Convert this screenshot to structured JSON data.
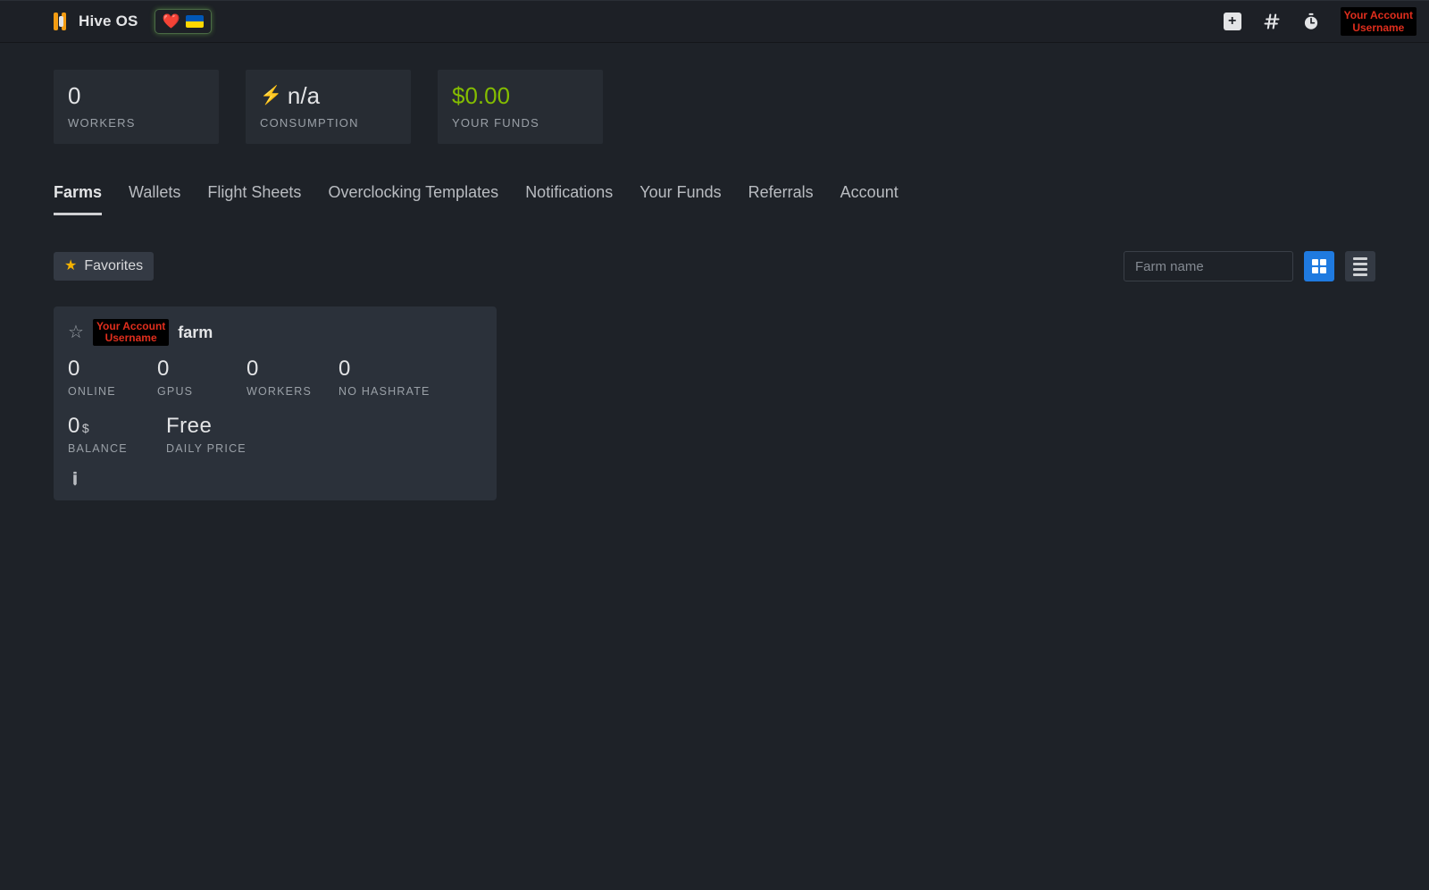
{
  "header": {
    "brand": "Hive OS",
    "flag_emoji": "❤️",
    "account_line1": "Your Account",
    "account_line2": "Username"
  },
  "stats": {
    "workers": {
      "value": "0",
      "label": "WORKERS"
    },
    "consumption": {
      "value": "n/a",
      "label": "CONSUMPTION"
    },
    "funds": {
      "value": "$0.00",
      "label": "YOUR FUNDS"
    }
  },
  "tabs": [
    "Farms",
    "Wallets",
    "Flight Sheets",
    "Overclocking Templates",
    "Notifications",
    "Your Funds",
    "Referrals",
    "Account"
  ],
  "toolbar": {
    "favorites_label": "Favorites",
    "search_placeholder": "Farm name"
  },
  "farms": [
    {
      "owner_line1": "Your Account",
      "owner_line2": "Username",
      "title_suffix": "farm",
      "online": {
        "value": "0",
        "label": "ONLINE"
      },
      "gpus": {
        "value": "0",
        "label": "GPUS"
      },
      "workers": {
        "value": "0",
        "label": "WORKERS"
      },
      "hashrate": {
        "value": "0",
        "label": "NO HASHRATE"
      },
      "balance": {
        "value": "0",
        "unit": "$",
        "label": "BALANCE"
      },
      "daily": {
        "value": "Free",
        "label": "DAILY PRICE"
      }
    }
  ]
}
